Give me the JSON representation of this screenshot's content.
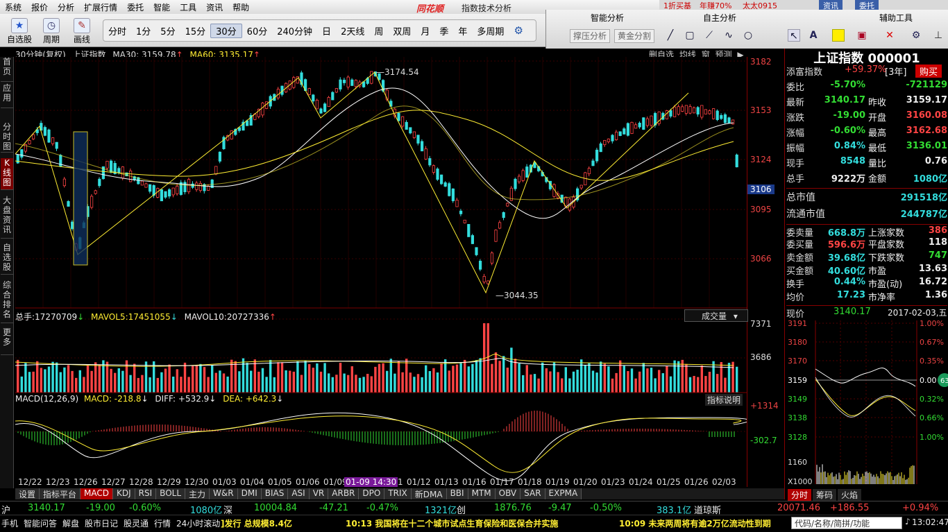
{
  "menu": [
    "系统",
    "报价",
    "分析",
    "扩展行情",
    "委托",
    "智能",
    "工具",
    "资讯",
    "帮助"
  ],
  "brand": "同花顺",
  "app_title": "指数技术分析",
  "top_right": {
    "promo1": "1折买基",
    "promo2": "年赚70%",
    "promo3": "太太0915",
    "btn1": "资讯",
    "btn2": "委托"
  },
  "toolbar": {
    "btn_zixuan": "自选股",
    "btn_period": "周期",
    "btn_draw": "画线"
  },
  "periods": [
    "分时",
    "1分",
    "5分",
    "15分",
    "30分",
    "60分",
    "240分钟",
    "日",
    "2天线",
    "周",
    "双周",
    "月",
    "季",
    "年",
    "多周期"
  ],
  "panels": {
    "smart": "智能分析",
    "self": "自主分析",
    "tools": "辅助工具",
    "btn_support": "撑压分析",
    "btn_golden": "黄金分割"
  },
  "side_tabs": [
    "首页",
    "应用",
    "分时图",
    "K线图",
    "大盘资讯",
    "自选股",
    "综合排名",
    "更多"
  ],
  "chart_head": {
    "period": "30分钟(复权)",
    "name": "上证指数",
    "ma30_label": "MA30:",
    "ma30": "3159.78",
    "ma60_label": "MA60:",
    "ma60": "3135.17"
  },
  "chart_links": [
    "删自选",
    "均线",
    "窗",
    "预测"
  ],
  "annot_high": "3174.54",
  "annot_low": "3044.35",
  "price_ticks": [
    "3182",
    "3153",
    "3124",
    "3106",
    "3095",
    "3066"
  ],
  "vol_head": {
    "total_label": "总手:",
    "total": "17270709",
    "mavol5_label": "MAVOL5:",
    "mavol5": "17451055",
    "mavol10_label": "MAVOL10:",
    "mavol10": "20727336",
    "dropdown": "成交量"
  },
  "vol_ticks": [
    "7371",
    "3686"
  ],
  "macd_head": {
    "title": "MACD(12,26,9)",
    "macd": "MACD: -218.8",
    "diff": "DIFF: +532.9",
    "dea": "DEA: +642.3",
    "help": "指标说明"
  },
  "macd_ticks": [
    "+1314",
    "-302.7"
  ],
  "dates": [
    "12/22",
    "12/23",
    "12/26",
    "12/27",
    "12/28",
    "12/29",
    "12/30",
    "01/03",
    "01/04",
    "01/05",
    "01/06",
    "01/09",
    "01/10",
    "01/11",
    "01/12",
    "01/13",
    "01/16",
    "01/17",
    "01/18",
    "01/19",
    "01/20",
    "01/23",
    "01/24",
    "01/25",
    "01/26",
    "02/03"
  ],
  "cursor_date": "01-09 14:30",
  "indicator_tabs": [
    "设置",
    "指标平台",
    "MACD",
    "KDJ",
    "RSI",
    "BOLL",
    "主力",
    "W&R",
    "DMI",
    "BIAS",
    "ASI",
    "VR",
    "ARBR",
    "DPO",
    "TRIX",
    "新DMA",
    "BBI",
    "MTM",
    "OBV",
    "SAR",
    "EXPMA"
  ],
  "quote": {
    "title": "上证指数 000001",
    "tianfu_label": "添富指数",
    "tianfu_val": "+59.37%",
    "tianfu_period": "[3年]",
    "buy": "购买",
    "weibi_label": "委比",
    "weibi": "-5.70%",
    "weicha": "-721129",
    "latest_label": "最新",
    "latest": "3140.17",
    "prev_label": "昨收",
    "prev": "3159.17",
    "change_label": "涨跌",
    "change": "-19.00",
    "open_label": "开盘",
    "open": "3160.08",
    "pct_label": "涨幅",
    "pct": "-0.60%",
    "high_label": "最高",
    "high": "3162.68",
    "amp_label": "振幅",
    "amp": "0.84%",
    "low_label": "最低",
    "low": "3136.01",
    "cur_label": "现手",
    "cur": "8548",
    "volratio_label": "量比",
    "volratio": "0.76",
    "total_label": "总手",
    "total": "9222万",
    "amount_label": "金额",
    "amount": "1080亿",
    "mktcap_label": "总市值",
    "mktcap": "291518亿",
    "float_label": "流通市值",
    "float": "244787亿",
    "sellvol_label": "委卖量",
    "sellvol": "668.8万",
    "up_label": "上涨家数",
    "up": "386",
    "buyvol_label": "委买量",
    "buyvol": "596.6万",
    "flat_label": "平盘家数",
    "flat": "118",
    "sellamt_label": "卖金额",
    "sellamt": "39.68亿",
    "down_label": "下跌家数",
    "down": "747",
    "buyamt_label": "买金额",
    "buyamt": "40.60亿",
    "pe_label": "市盈",
    "pe": "13.63",
    "turn_label": "换手",
    "turn": "0.44%",
    "pedyn_label": "市盈(动)",
    "pedyn": "16.72",
    "avg_label": "均价",
    "avg": "17.23",
    "pb_label": "市净率",
    "pb": "1.36"
  },
  "mini": {
    "now_label": "现价",
    "now": "3140.17",
    "date": "2017-02-03,五",
    "left_ticks": [
      "3191",
      "3180",
      "3170",
      "3159",
      "3149",
      "3138",
      "3128",
      "1160",
      "X1000"
    ],
    "right_ticks": [
      "1.00%",
      "0.67%",
      "0.35%",
      "0.00",
      "0.32%",
      "0.66%",
      "1.00%"
    ],
    "badge": "63",
    "tabs": [
      "分时",
      "筹码",
      "火焰"
    ]
  },
  "ticker": {
    "sh": "沪",
    "sh_price": "3140.17",
    "sh_chg": "-19.00",
    "sh_pct": "-0.60%",
    "sh_amt": "1080亿",
    "sz": "深",
    "sz_price": "10004.84",
    "sz_chg": "-47.21",
    "sz_pct": "-0.47%",
    "sz_amt": "1321亿",
    "cy": "创",
    "cy_price": "1876.76",
    "cy_chg": "-9.47",
    "cy_pct": "-0.50%",
    "cy_amt": "383.1亿",
    "dj": "道琼斯",
    "dj_price": "20071.46",
    "dj_chg": "+186.55",
    "dj_pct": "+0.94%"
  },
  "status": {
    "items": [
      "手机",
      "智能问答",
      "解盘",
      "股市日记",
      "股灵通",
      "行情",
      "24小时滚动"
    ],
    "news1": "]发行 总规模8.4亿",
    "news2": "10:13 我国将在十二个城市试点生育保险和医保合并实施",
    "news3": "10:09 未来两周将有逾2万亿流动性到期",
    "search": "代码/名称/简拼/功能",
    "time": "13:02:47"
  },
  "colors": {
    "up": "#ff4444",
    "down": "#33dddd",
    "ma30": "#ffffff",
    "ma60": "#ffee33",
    "axis": "#aa0000"
  }
}
